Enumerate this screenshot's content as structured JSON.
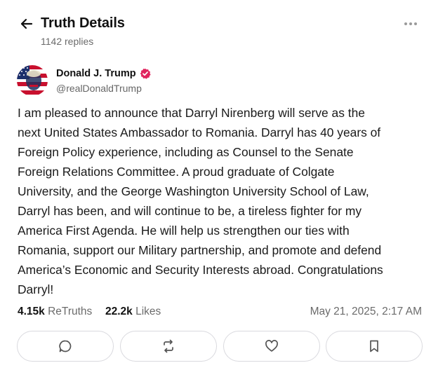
{
  "header": {
    "back_icon": "arrow-left-icon",
    "title": "Truth Details",
    "replies": "1142 replies",
    "more_icon": "more-horizontal-icon"
  },
  "post": {
    "author_name": "Donald J. Trump",
    "author_handle": "@realDonaldTrump",
    "verified_icon": "verified-badge-icon",
    "verified_color": "#e0245e",
    "body_lines": [
      "I am pleased to announce that Darryl Nirenberg will serve as the",
      "next United States Ambassador to Romania. Darryl has 40 years of",
      "Foreign Policy experience, including as Counsel to the Senate",
      "Foreign Relations Committee. A proud graduate of Colgate",
      "University, and the George Washington University School of Law,",
      "Darryl has been, and will continue to be, a tireless fighter for my",
      "America First Agenda. He will help us strengthen our ties with",
      "Romania, support our Military partnership, and promote and defend",
      "America’s Economic and Security Interests abroad. Congratulations",
      "Darryl!"
    ],
    "retruths_count": "4.15k",
    "retruths_label": "ReTruths",
    "likes_count": "22.2k",
    "likes_label": "Likes",
    "timestamp": "May 21, 2025, 2:17 AM"
  },
  "actions": [
    {
      "name": "reply",
      "icon": "reply-icon"
    },
    {
      "name": "retruth",
      "icon": "retruth-icon"
    },
    {
      "name": "like",
      "icon": "heart-icon"
    },
    {
      "name": "bookmark",
      "icon": "bookmark-icon"
    }
  ]
}
